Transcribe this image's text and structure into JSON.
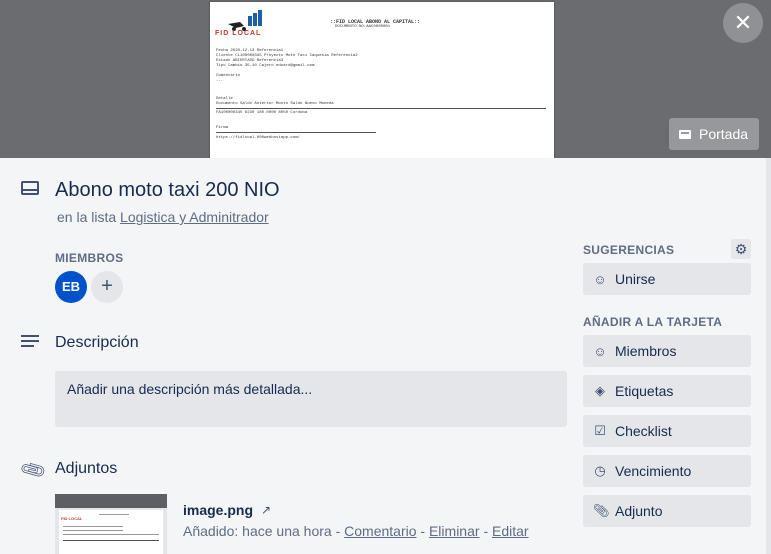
{
  "cover": {
    "doc_title": "::FID LOCAL ABONO AL CAPITAL::",
    "doc_subtitle": "DOCUMENTO NO:AAC0000001",
    "doc_logo": "FID LOCAL",
    "rows": [
      "Fecha          2020-12-13                                         Referencia1",
      "Cliente        CL100000345 Proyecto Moto Taxi Caquesia             Referencia2",
      "Estado         ABIERTADO                                          Referencia3",
      "Tipo Cambio    35.10                                              Cajero          eduard@gmail.com",
      "Comentario",
      "---",
      "Detalle",
      "Documento       Saldo Anterior        Monto          Saldo Nuevo       Moneda",
      "FA100000345     8230                  180.0000       8050              Cordoba",
      "Firma",
      "https://fidlocal.000webhostapp.com/"
    ],
    "portada_label": "Portada",
    "close_label": "✕"
  },
  "card": {
    "title": "Abono moto taxi 200 NIO",
    "list_prefix": "en la lista",
    "list_name": "Logistica y Adminitrador"
  },
  "members": {
    "label": "MIEMBROS",
    "avatar_initials": "EB",
    "add_label": "+"
  },
  "description": {
    "title": "Descripción",
    "placeholder": "Añadir una descripción más detallada..."
  },
  "attachments": {
    "title": "Adjuntos",
    "file_name": "image.png",
    "added_prefix": "Añadido: hace una hora",
    "sep": "-",
    "comment_link": "Comentario",
    "delete_link": "Eliminar",
    "edit_link": "Editar",
    "thumb_logo": "FID LOCAL"
  },
  "sidebar": {
    "suggestions_label": "SUGERENCIAS",
    "join_label": "Unirse",
    "add_to_card_label": "AÑADIR A LA TARJETA",
    "buttons": [
      {
        "label": "Miembros",
        "icon": "person-icon"
      },
      {
        "label": "Etiquetas",
        "icon": "tag-icon"
      },
      {
        "label": "Checklist",
        "icon": "checkbox-icon"
      },
      {
        "label": "Vencimiento",
        "icon": "clock-icon"
      },
      {
        "label": "Adjunto",
        "icon": "paperclip-icon"
      }
    ]
  }
}
